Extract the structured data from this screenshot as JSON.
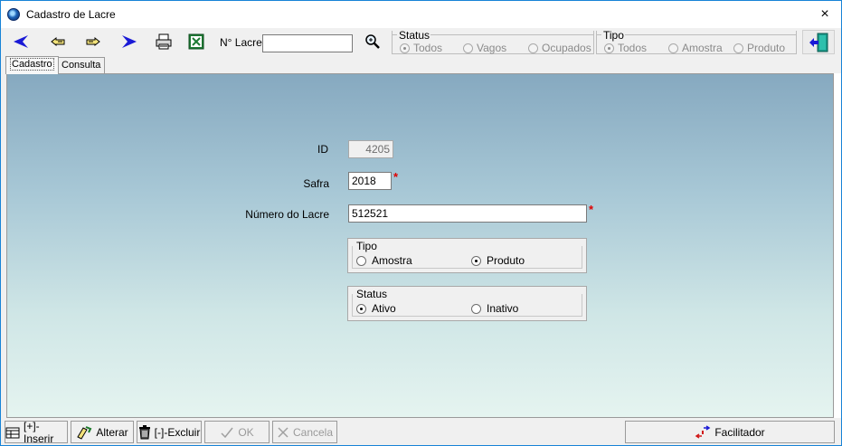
{
  "window": {
    "title": "Cadastro de Lacre",
    "close_icon": "×"
  },
  "toolbar": {
    "nav_buttons": [
      "first-record-icon",
      "previous-record-icon",
      "next-record-icon",
      "last-record-icon",
      "print-icon",
      "excel-export-icon"
    ],
    "nlacre_label": "N° Lacre",
    "nlacre_value": "",
    "status": {
      "title": "Status",
      "options": [
        "Todos",
        "Vagos",
        "Ocupados"
      ],
      "selected": "Todos"
    },
    "tipo": {
      "title": "Tipo",
      "options": [
        "Todos",
        "Amostra",
        "Produto"
      ],
      "selected": "Todos"
    }
  },
  "tabs": [
    {
      "label": "Cadastro",
      "active": true
    },
    {
      "label": "Consulta",
      "active": false
    }
  ],
  "form": {
    "id_label": "ID",
    "id_value": "4205",
    "safra_label": "Safra",
    "safra_value": "2018",
    "numero_label": "Número do Lacre",
    "numero_value": "512521",
    "required_mark": "*",
    "tipo": {
      "title": "Tipo",
      "options": [
        "Amostra",
        "Produto"
      ],
      "selected": "Produto"
    },
    "status": {
      "title": "Status",
      "options": [
        "Ativo",
        "Inativo"
      ],
      "selected": "Ativo"
    }
  },
  "bottom": {
    "inserir": "[+]-Inserir",
    "alterar": "Alterar",
    "excluir": "[-]-Excluir",
    "ok": "OK",
    "cancela": "Cancela",
    "facilitador": "Facilitador"
  },
  "colors": {
    "accent": "#1883d7",
    "required": "#e00000",
    "nav_blue": "#1a1ad6"
  }
}
